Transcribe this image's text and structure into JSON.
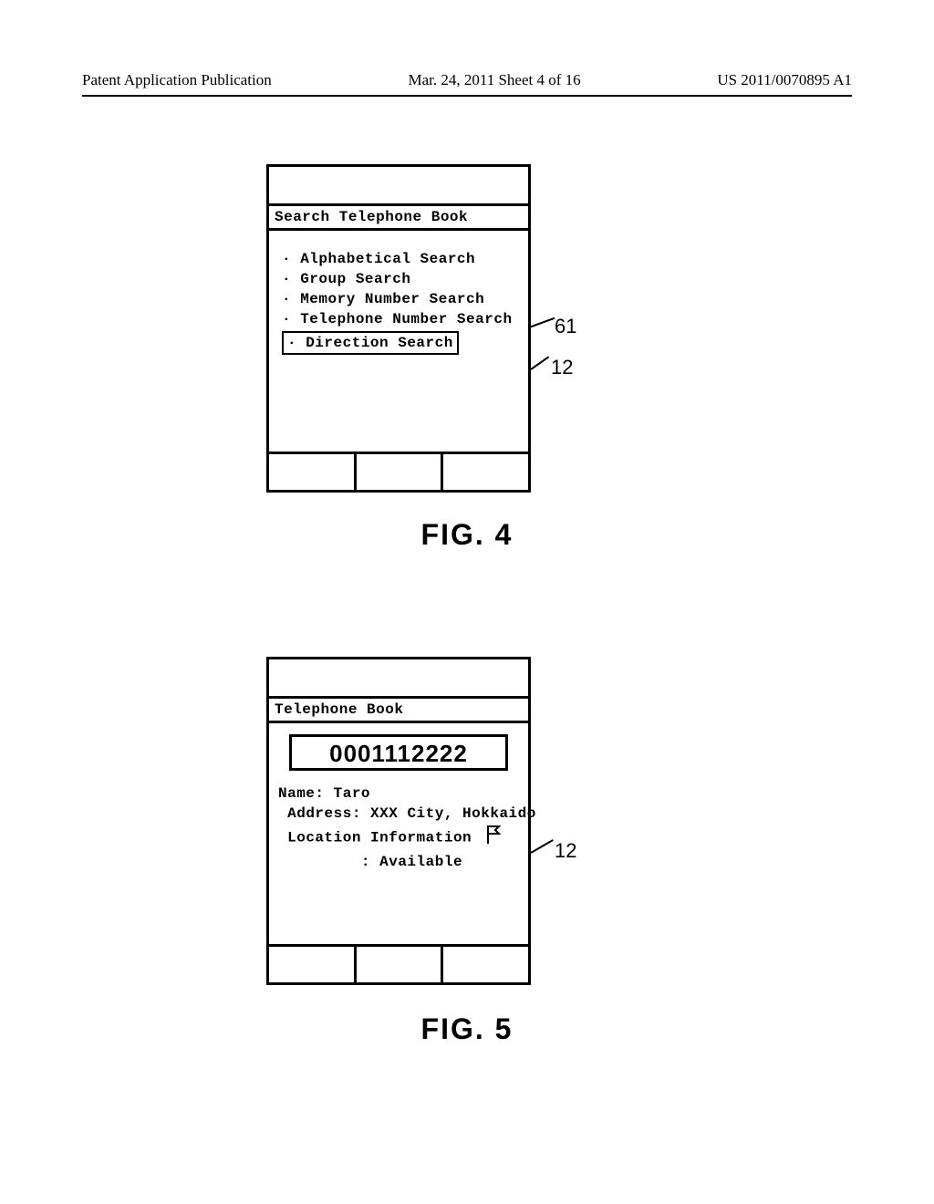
{
  "header": {
    "left": "Patent Application Publication",
    "mid": "Mar. 24, 2011  Sheet 4 of 16",
    "right": "US 2011/0070895 A1"
  },
  "fig4": {
    "screen_title": "Search Telephone Book",
    "menu": {
      "items": [
        "Alphabetical Search",
        "Group Search",
        "Memory Number Search",
        "Telephone Number Search",
        "Direction Search"
      ],
      "selected_index": 4
    },
    "callouts": {
      "selected": "61",
      "screen": "12"
    },
    "caption": "FIG. 4"
  },
  "fig5": {
    "screen_title": "Telephone Book",
    "phone_number": "0001112222",
    "name_label": "Name:",
    "name_value": "Taro",
    "address_label": "Address:",
    "address_value": "XXX City, Hokkaido",
    "location_label": "Location Information",
    "location_value": ": Available",
    "location_icon": "flag-icon",
    "callouts": {
      "screen": "12"
    },
    "caption": "FIG. 5"
  }
}
